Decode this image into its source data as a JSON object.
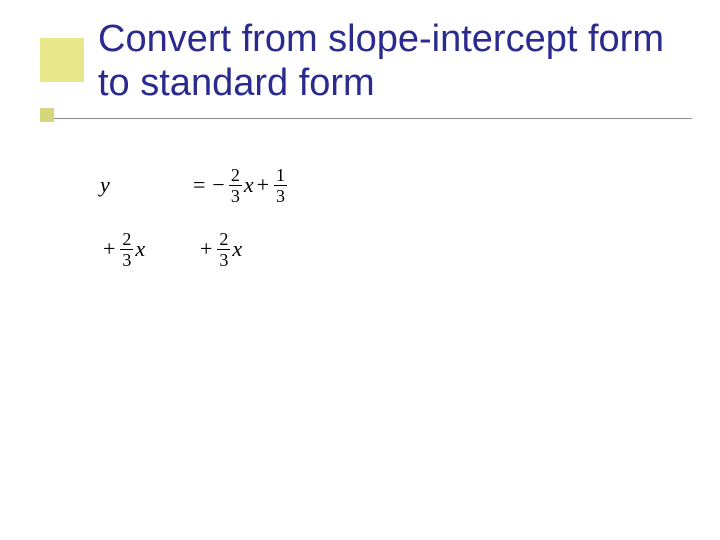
{
  "title": "Convert from slope-intercept form to standard form",
  "math": {
    "row1": {
      "lhs_var": "y",
      "eq": "=",
      "neg": "−",
      "frac1_num": "2",
      "frac1_den": "3",
      "var_x1": "x",
      "plus1": "+",
      "frac2_num": "1",
      "frac2_den": "3"
    },
    "row2": {
      "lhs_plus": "+",
      "lhs_frac_num": "2",
      "lhs_frac_den": "3",
      "lhs_var": "x",
      "rhs_plus": "+",
      "rhs_frac_num": "2",
      "rhs_frac_den": "3",
      "rhs_var": "x"
    }
  }
}
